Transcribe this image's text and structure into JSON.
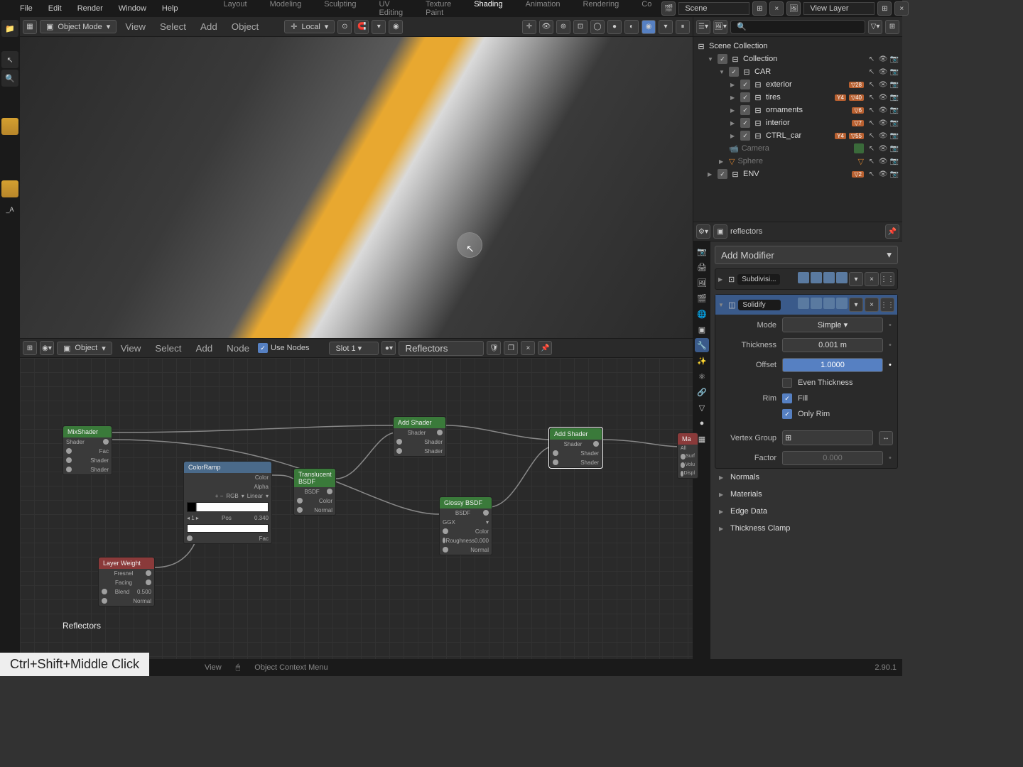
{
  "app": {
    "version": "2.90.1"
  },
  "menu": [
    "File",
    "Edit",
    "Render",
    "Window",
    "Help"
  ],
  "workspaces": [
    "Layout",
    "Modeling",
    "Sculpting",
    "UV Editing",
    "Texture Paint",
    "Shading",
    "Animation",
    "Rendering",
    "Co"
  ],
  "active_workspace": "Shading",
  "scene_name": "Scene",
  "layer_name": "View Layer",
  "viewport": {
    "mode": "Object Mode",
    "menus": [
      "View",
      "Select",
      "Add",
      "Object"
    ],
    "orientation": "Local"
  },
  "node_editor": {
    "mode": "Object",
    "menus": [
      "View",
      "Select",
      "Add",
      "Node"
    ],
    "use_nodes_label": "Use Nodes",
    "slot": "Slot 1",
    "material": "Reflectors",
    "footer_label": "Reflectors",
    "nodes": {
      "mix_shader": "MixShader",
      "color_ramp": "ColorRamp",
      "layer_weight": "Layer Weight",
      "translucent": "Translucent BSDF",
      "add1": "Add Shader",
      "add2": "Add Shader",
      "glossy": "Glossy BSDF",
      "material_out": "Ma"
    },
    "sockets": {
      "fac": "Fac",
      "shader": "Shader",
      "color": "Color",
      "alpha": "Alpha",
      "bsdf": "BSDF",
      "normal": "Normal",
      "roughness": "Roughness",
      "fresnel": "Fresnel",
      "facing": "Facing",
      "blend": "Blend",
      "surface": "Surf",
      "volume": "Volu",
      "displacement": "Displ",
      "pos": "Pos",
      "ggx": "GGX",
      "linear": "Linear",
      "rgb": "RGB"
    },
    "values": {
      "blend": "0.500",
      "pos": "0.340",
      "roughness": "0.000"
    }
  },
  "outliner": {
    "root": "Scene Collection",
    "collection": "Collection",
    "items": [
      {
        "name": "CAR",
        "type": "collection"
      },
      {
        "name": "exterior",
        "type": "collection",
        "badge": "28"
      },
      {
        "name": "tires",
        "type": "collection",
        "badge": "4",
        "badge2": "40"
      },
      {
        "name": "ornaments",
        "type": "collection",
        "badge": "6"
      },
      {
        "name": "interior",
        "type": "collection",
        "badge": "7"
      },
      {
        "name": "CTRL_car",
        "type": "collection",
        "badge": "4",
        "badge2": "55"
      },
      {
        "name": "Camera",
        "type": "camera",
        "dim": true
      },
      {
        "name": "Sphere",
        "type": "sphere",
        "dim": true
      },
      {
        "name": "ENV",
        "type": "collection",
        "badge": "2"
      }
    ]
  },
  "properties": {
    "object_name": "reflectors",
    "add_modifier": "Add Modifier",
    "modifiers": [
      {
        "name": "Subdivisi..."
      },
      {
        "name": "Solidify",
        "expanded": true
      }
    ],
    "solidify": {
      "mode_label": "Mode",
      "mode_value": "Simple",
      "thickness_label": "Thickness",
      "thickness_value": "0.001 m",
      "offset_label": "Offset",
      "offset_value": "1.0000",
      "even_label": "Even Thickness",
      "rim_label": "Rim",
      "fill_label": "Fill",
      "only_rim_label": "Only Rim",
      "vgroup_label": "Vertex Group",
      "factor_label": "Factor",
      "factor_value": "0.000"
    },
    "sections": [
      "Normals",
      "Materials",
      "Edge Data",
      "Thickness Clamp"
    ]
  },
  "statusbar": {
    "context_menu": "Object Context Menu",
    "view": "View"
  },
  "key_hint": "Ctrl+Shift+Middle Click"
}
